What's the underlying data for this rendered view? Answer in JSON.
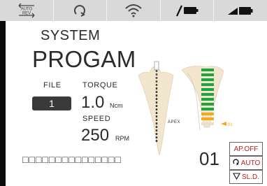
{
  "toolbar": {
    "auto_rev": "AUTO REV",
    "icons": [
      "auto-reverse-icon",
      "rotate-icon",
      "wifi-icon",
      "file-battery-icon",
      "handpiece-battery-icon"
    ]
  },
  "system_label": "SYSTEM",
  "program_label": "PROGAM",
  "file": {
    "label": "FILE",
    "value": "1"
  },
  "torque": {
    "label": "TORQUE",
    "value": "1.0",
    "unit": "Ncm"
  },
  "speed": {
    "label": "SPEED",
    "value": "250",
    "unit": "RPM"
  },
  "status_text": "□□□□□□□□□□□□□□□",
  "file_number": "01",
  "apex": {
    "label": "APEX",
    "marker": "01",
    "bars_total": 12,
    "bars_green": 9,
    "bars_orange": 2
  },
  "modes": {
    "ap_off": "AP.OFF",
    "auto": "AUTO",
    "sld": "SL.D."
  },
  "colors": {
    "accent_red": "#c01f1f",
    "green": "#1fa33c",
    "orange": "#f2a91c",
    "toolbar_bg": "#d9d9d9"
  }
}
